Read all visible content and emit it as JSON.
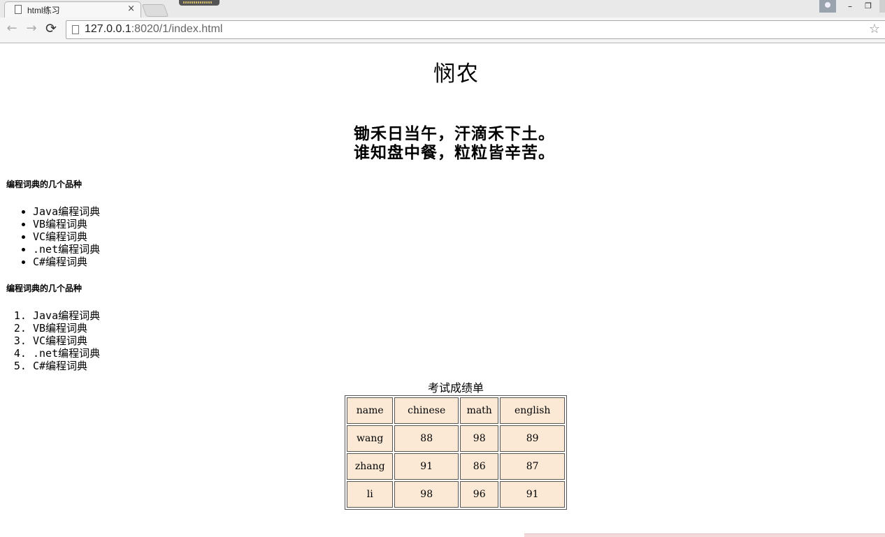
{
  "browser": {
    "tab_title": "html练习",
    "tab_close": "×",
    "url_host": "127.0.0.1",
    "url_rest": ":8020/1/index.html",
    "back": "←",
    "forward": "→",
    "reload": "⟳",
    "star": "☆",
    "minimize": "–",
    "maximize": "❐"
  },
  "page": {
    "title": "悯农",
    "poem_line1": "锄禾日当午，汗滴禾下土。",
    "poem_line2": "谁知盘中餐，粒粒皆辛苦。",
    "ul_heading": "编程词典的几个品种",
    "ul_items": [
      "Java编程词典",
      "VB编程词典",
      "VC编程词典",
      ".net编程词典",
      "C#编程词典"
    ],
    "ol_heading": "编程词典的几个品种",
    "ol_items": [
      "Java编程词典",
      "VB编程词典",
      "VC编程词典",
      ".net编程词典",
      "C#编程词典"
    ],
    "table": {
      "caption": "考试成绩单",
      "headers": [
        "name",
        "chinese",
        "math",
        "english"
      ],
      "rows": [
        [
          "wang",
          "88",
          "98",
          "89"
        ],
        [
          "zhang",
          "91",
          "86",
          "87"
        ],
        [
          "li",
          "98",
          "96",
          "91"
        ]
      ],
      "cell_color": "#fbe9d6"
    }
  }
}
